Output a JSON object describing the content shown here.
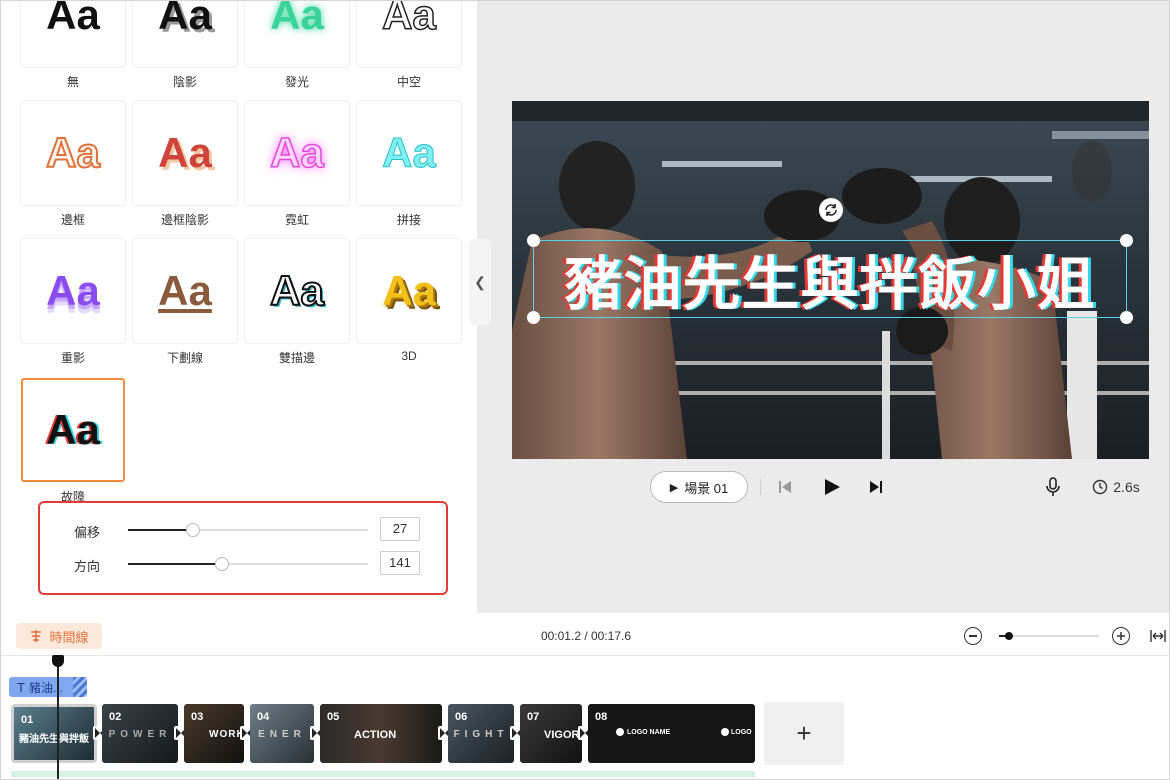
{
  "styles": [
    {
      "label": "無"
    },
    {
      "label": "陰影"
    },
    {
      "label": "發光"
    },
    {
      "label": "中空"
    },
    {
      "label": "邊框"
    },
    {
      "label": "邊框陰影"
    },
    {
      "label": "霓虹"
    },
    {
      "label": "拼接"
    },
    {
      "label": "重影"
    },
    {
      "label": "下劃線"
    },
    {
      "label": "雙描邊"
    },
    {
      "label": "3D"
    },
    {
      "label": "故障"
    }
  ],
  "sample_text": "Aa",
  "controls": {
    "offset": {
      "label": "偏移",
      "value": "27",
      "fraction": 0.27
    },
    "direction": {
      "label": "方向",
      "value": "141",
      "fraction": 0.39
    }
  },
  "preview": {
    "caption": "豬油先生與拌飯小姐",
    "scene_button": "場景 01",
    "duration": "2.6s"
  },
  "timeline": {
    "button_label": "時間線",
    "time": "00:01.2 / 00:17.6",
    "text_track_label": "豬油...",
    "zoom_level": 0.1,
    "clips": [
      {
        "num": "01",
        "text": "豬油先生與拌飯"
      },
      {
        "num": "02",
        "text": "POWER"
      },
      {
        "num": "03",
        "text": "WORK"
      },
      {
        "num": "04",
        "text": "ENER"
      },
      {
        "num": "05",
        "text": "ACTION"
      },
      {
        "num": "06",
        "text": "FIGHT"
      },
      {
        "num": "07",
        "text": "VIGOR"
      },
      {
        "num": "08",
        "text": "LOGO NAME",
        "text2": "LOGO"
      }
    ],
    "add_label": "+"
  },
  "colors": {
    "accent": "#f08a3e",
    "selection": "#e53935",
    "caption_outline": "#34d6e8"
  },
  "icons": [
    "collapse-chevron-left-icon",
    "play-icon",
    "skip-back-icon",
    "skip-forward-icon",
    "microphone-icon",
    "clock-icon",
    "rotate-icon",
    "timeline-icon",
    "text-icon",
    "transition-icon",
    "zoom-out-icon",
    "zoom-in-icon",
    "fit-width-icon"
  ]
}
